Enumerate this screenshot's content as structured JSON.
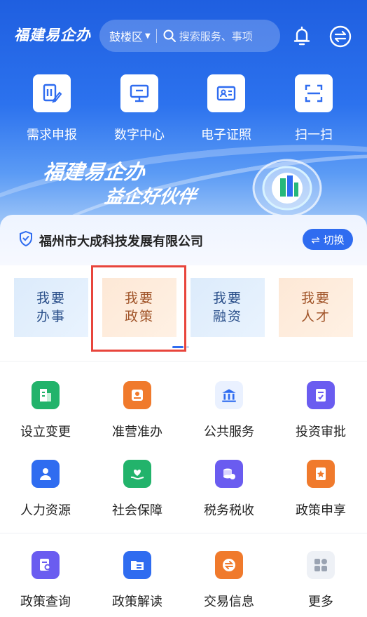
{
  "header": {
    "brand": "福建易企办",
    "district": "鼓楼区",
    "search_placeholder": "搜索服务、事项"
  },
  "quick_actions": [
    {
      "label": "需求申报",
      "icon": "document-edit-icon"
    },
    {
      "label": "数字中心",
      "icon": "monitor-icon"
    },
    {
      "label": "电子证照",
      "icon": "id-card-icon"
    },
    {
      "label": "扫一扫",
      "icon": "scan-icon"
    }
  ],
  "banner": {
    "slogan_line1": "福建易企办",
    "slogan_line2": "益企好伙伴"
  },
  "company": {
    "name": "福州市大成科技发展有限公司",
    "switch_label": "⇌ 切换"
  },
  "want_cards": [
    {
      "line1": "我要",
      "line2": "办事",
      "theme": "blue"
    },
    {
      "line1": "我要",
      "line2": "政策",
      "theme": "orange",
      "highlighted": true
    },
    {
      "line1": "我要",
      "line2": "融资",
      "theme": "blue"
    },
    {
      "line1": "我要",
      "line2": "人才",
      "theme": "orange"
    }
  ],
  "services": [
    {
      "label": "设立变更",
      "icon": "building-icon",
      "color": "#22b36b"
    },
    {
      "label": "准营准办",
      "icon": "stamp-icon",
      "color": "#f07a2c"
    },
    {
      "label": "公共服务",
      "icon": "bank-icon",
      "color": "#2f6cf0"
    },
    {
      "label": "投资审批",
      "icon": "approval-doc-icon",
      "color": "#6a5cf0"
    },
    {
      "label": "人力资源",
      "icon": "person-icon",
      "color": "#2f6cf0"
    },
    {
      "label": "社会保障",
      "icon": "heart-hand-icon",
      "color": "#22b36b"
    },
    {
      "label": "税务税收",
      "icon": "tax-coins-icon",
      "color": "#6a5cf0"
    },
    {
      "label": "政策申享",
      "icon": "star-doc-icon",
      "color": "#f07a2c"
    },
    {
      "label": "政策查询",
      "icon": "doc-search-icon",
      "color": "#6a5cf0"
    },
    {
      "label": "政策解读",
      "icon": "folder-doc-icon",
      "color": "#2f6cf0"
    },
    {
      "label": "交易信息",
      "icon": "exchange-icon",
      "color": "#f07a2c"
    },
    {
      "label": "更多",
      "icon": "more-grid-icon",
      "color": "#9aa3b2"
    }
  ]
}
